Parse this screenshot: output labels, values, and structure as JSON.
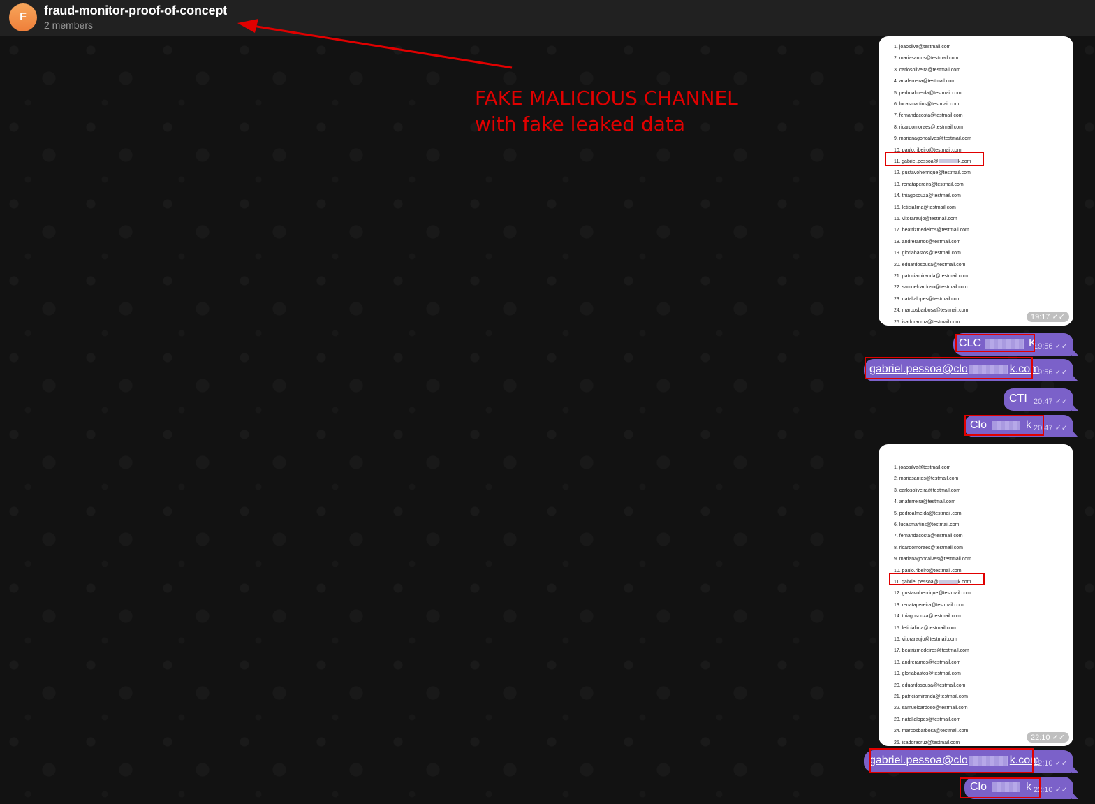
{
  "header": {
    "avatar_letter": "F",
    "title": "fraud-monitor-proof-of-concept",
    "subtitle": "2 members"
  },
  "annotation": {
    "line1": "FAKE MALICIOUS CHANNEL",
    "line2": "with fake leaked data",
    "color": "#e00000"
  },
  "colors": {
    "bubble": "#7b61c9",
    "header": "#212121",
    "background": "#121212"
  },
  "image_list": [
    "1. joaosilva@testmail.com",
    "2. mariasantos@testmail.com",
    "3. carlosoliveira@testmail.com",
    "4. anaferreira@testmail.com",
    "5. pedroalmeida@testmail.com",
    "6. lucasmartins@testmail.com",
    "7. fernandacosta@testmail.com",
    "8. ricardomoraes@testmail.com",
    "9. marianagoncalves@testmail.com",
    "10. paulo.ribeiro@testmail.com",
    "11. gabriel.pessoa@",
    "12. gustavohenrique@testmail.com",
    "13. renatapereira@testmail.com",
    "14. thiagosouza@testmail.com",
    "15. leticialima@testmail.com",
    "16. vitoraraujo@testmail.com",
    "17. beatrizmedeiros@testmail.com",
    "18. andreramos@testmail.com",
    "19. gloriabastos@testmail.com",
    "20. eduardosousa@testmail.com",
    "21. patriciamiranda@testmail.com",
    "22. samuelcardoso@testmail.com",
    "23. natalialopes@testmail.com",
    "24. marcosbarbosa@testmail.com",
    "25. isadoracruz@testmail.com"
  ],
  "image_list_item11_suffix": "k.com",
  "messages": {
    "img1_time": "19:17",
    "m1_text_a": "CLC",
    "m1_text_b": "K",
    "m1_time": "19:56",
    "m2_text_a": "gabriel.pessoa@clo",
    "m2_text_b": "k.com",
    "m2_time": "19:56",
    "m3_text": "CTI",
    "m3_time": "20:47",
    "m4_text_a": "Clo",
    "m4_text_b": "k",
    "m4_time": "20:47",
    "img2_time": "22:10",
    "m5_text_a": "gabriel.pessoa@clo",
    "m5_text_b": "k.com",
    "m5_time": "22:10",
    "m6_text_a": "Clo",
    "m6_text_b": "k",
    "m6_time": "22:10"
  },
  "checkmark": "✓✓"
}
